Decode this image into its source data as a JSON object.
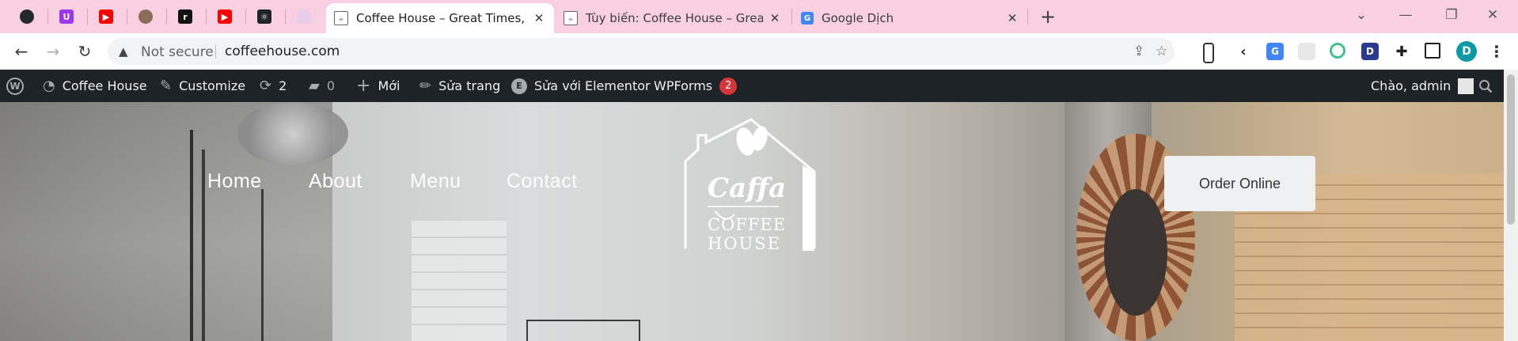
{
  "browser": {
    "pinned_tabs": [
      {
        "icon": "github-icon",
        "color": "#24292f",
        "glyph": ""
      },
      {
        "icon": "scrimba-icon",
        "color": "#9b35ef",
        "glyph": "U"
      },
      {
        "icon": "youtube-icon",
        "color": "#ff0000",
        "glyph": "▶"
      },
      {
        "icon": "avatar-cat-icon",
        "color": "#8a6d5a",
        "glyph": ""
      },
      {
        "icon": "rlogo-icon",
        "color": "#111111",
        "glyph": "r"
      },
      {
        "icon": "youtube-icon",
        "color": "#ff0000",
        "glyph": "▶"
      },
      {
        "icon": "react-icon",
        "color": "#20232a",
        "glyph": "⚛"
      },
      {
        "icon": "blank-tab-icon",
        "color": "#e9cce8",
        "glyph": ""
      }
    ],
    "tabs": [
      {
        "title": "Coffee House – Great Times, Goo",
        "active": true
      },
      {
        "title": "Tùy biến: Coffee House – Great T",
        "active": false
      },
      {
        "title": "Google Dịch",
        "active": false
      }
    ],
    "tab_close": "✕",
    "new_tab": "+",
    "window_controls": {
      "dropdown": "⌄",
      "minimize": "—",
      "maximize": "❐",
      "close": "✕"
    }
  },
  "toolbar": {
    "back": "←",
    "forward": "→",
    "reload": "↻",
    "security": "Not secure",
    "url": "coffeehouse.com",
    "avatar_letter": "D"
  },
  "adminbar": {
    "site_name": "Coffee House",
    "customize": "Customize",
    "updates_count": "2",
    "comments_count": "0",
    "new_label": "Mới",
    "edit_page": "Sửa trang",
    "elementor": "Sửa với Elementor",
    "wpforms": "WPForms",
    "wpforms_badge": "2",
    "greeting": "Chào, admin"
  },
  "hero": {
    "nav": [
      "Home",
      "About",
      "Menu",
      "Contact"
    ],
    "logo_brand": "Caffa",
    "logo_line1": "COFFEE",
    "logo_line2": "HOUSE",
    "order_button": "Order Online"
  }
}
